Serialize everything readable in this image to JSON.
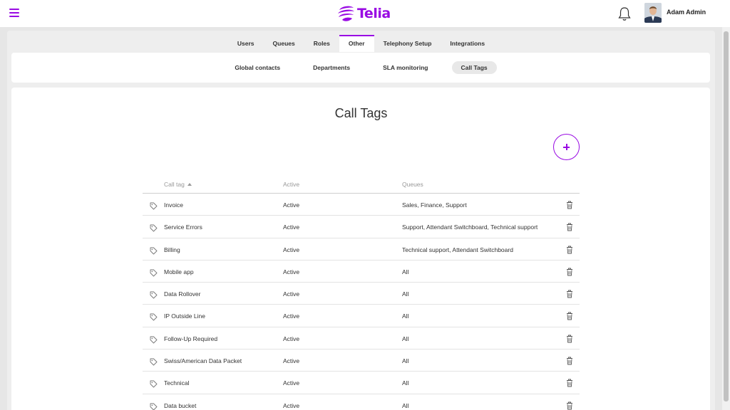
{
  "header": {
    "brand": "Telia",
    "user_name": "Adam Admin",
    "brand_color": "#990ae3"
  },
  "main_tabs": [
    {
      "label": "Users",
      "active": false
    },
    {
      "label": "Queues",
      "active": false
    },
    {
      "label": "Roles",
      "active": false
    },
    {
      "label": "Other",
      "active": true
    },
    {
      "label": "Telephony Setup",
      "active": false
    },
    {
      "label": "Integrations",
      "active": false
    }
  ],
  "sub_tabs": [
    {
      "label": "Global contacts",
      "active": false
    },
    {
      "label": "Departments",
      "active": false
    },
    {
      "label": "SLA monitoring",
      "active": false
    },
    {
      "label": "Call Tags",
      "active": true
    }
  ],
  "page": {
    "title": "Call Tags",
    "add_icon": "plus-icon"
  },
  "table": {
    "columns": [
      "Call tag",
      "Active",
      "Queues"
    ],
    "sort_column": "Call tag",
    "sort_direction": "ascending",
    "rows": [
      {
        "name": "Invoice",
        "active": "Active",
        "queues": "Sales, Finance, Support"
      },
      {
        "name": "Service Errors",
        "active": "Active",
        "queues": "Support, Attendant Switchboard, Technical support"
      },
      {
        "name": "Billing",
        "active": "Active",
        "queues": "Technical support, Attendant Switchboard"
      },
      {
        "name": "Mobile app",
        "active": "Active",
        "queues": "All"
      },
      {
        "name": "Data Rollover",
        "active": "Active",
        "queues": "All"
      },
      {
        "name": "IP Outside Line",
        "active": "Active",
        "queues": "All"
      },
      {
        "name": "Follow-Up Required",
        "active": "Active",
        "queues": "All"
      },
      {
        "name": "Swiss/American Data Packet",
        "active": "Active",
        "queues": "All"
      },
      {
        "name": "Technical",
        "active": "Active",
        "queues": "All"
      },
      {
        "name": "Data bucket",
        "active": "Active",
        "queues": "All"
      }
    ]
  }
}
